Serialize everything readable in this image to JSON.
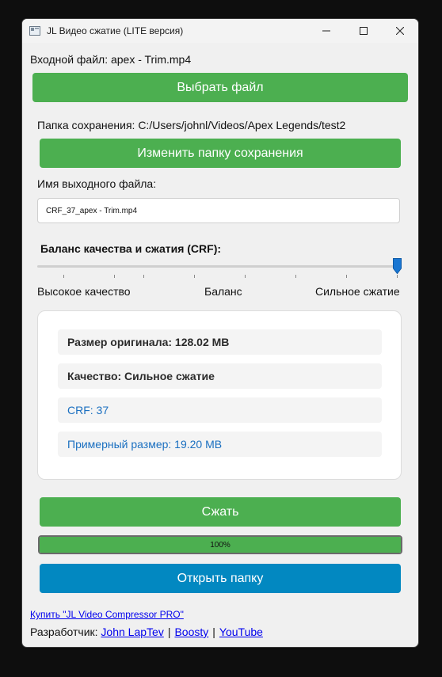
{
  "window": {
    "title": "JL Видео сжатие (LITE версия)"
  },
  "input": {
    "label": "Входной файл: apex - Trim.mp4",
    "choose_button": "Выбрать файл"
  },
  "output_folder": {
    "label": "Папка сохранения: C:/Users/johnl/Videos/Apex Legends/test2",
    "change_button": "Изменить папку сохранения"
  },
  "output_name": {
    "label": "Имя выходного файла:",
    "value": "CRF_37_apex - Trim.mp4"
  },
  "crf": {
    "heading": "Баланс качества и сжатия (CRF):",
    "slider_level": 1.0,
    "left_label": "Высокое качество",
    "mid_label": "Баланс",
    "right_label": "Сильное сжатие"
  },
  "info": {
    "original_size": "Размер оригинала: 128.02 MB",
    "quality": "Качество: Сильное сжатие",
    "crf_value": "CRF: 37",
    "estimated_size": "Примерный размер: 19.20 MB"
  },
  "actions": {
    "compress_button": "Сжать",
    "progress_percent": 100,
    "progress_text": "100%",
    "open_folder_button": "Открыть папку"
  },
  "footer": {
    "buy_link": "Купить \"JL Video Compressor PRO\"",
    "developer_label": "Разработчик:",
    "developer_name": "John LapTev",
    "sep1": "|",
    "link_boosty": "Boosty",
    "sep2": "|",
    "link_youtube": "YouTube"
  },
  "colors": {
    "green": "#4caf50",
    "blue": "#0288c1",
    "link": "#0000ee",
    "info_blue": "#1a6fc0"
  }
}
